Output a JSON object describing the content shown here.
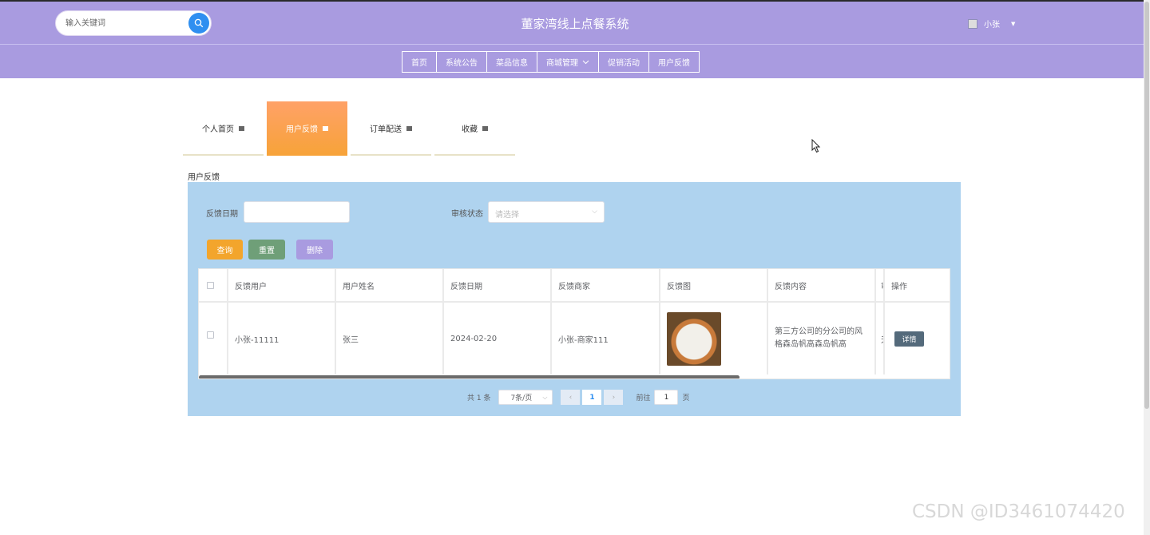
{
  "header": {
    "search_placeholder": "输入关键词",
    "site_title": "董家湾线上点餐系统",
    "username": "小张"
  },
  "nav": [
    "首页",
    "系统公告",
    "菜品信息",
    "商城管理",
    "促销活动",
    "用户反馈"
  ],
  "tabs": [
    {
      "label": "个人首页",
      "active": false
    },
    {
      "label": "用户反馈",
      "active": true
    },
    {
      "label": "订单配送",
      "active": false
    },
    {
      "label": "收藏",
      "active": false
    }
  ],
  "section_label": "用户反馈",
  "filters": {
    "date_label": "反馈日期",
    "status_label": "审核状态",
    "status_placeholder": "请选择"
  },
  "buttons": {
    "query": "查询",
    "reset": "重置",
    "delete": "删除"
  },
  "colors": {
    "header": "#a99be0",
    "tab_active": "#f7a33a",
    "panel": "#afd3ef",
    "query": "#f3a52c",
    "reset": "#6f9f78",
    "delete": "#a99be0",
    "detail": "#546a7b"
  },
  "table": {
    "headers": [
      "反馈用户",
      "用户姓名",
      "反馈日期",
      "反馈商家",
      "反馈图",
      "反馈内容",
      "审",
      "操作"
    ],
    "rows": [
      {
        "user": "小张-11111",
        "name": "张三",
        "date": "2024-02-20",
        "merchant": "小张-商家111",
        "content": "第三方公司的分公司的风格森岛帆高森岛帆高",
        "review_truncated": "天",
        "action": "详情"
      }
    ]
  },
  "pager": {
    "total": "共 1 条",
    "page_size": "7条/页",
    "prev": "‹",
    "current": "1",
    "next": "›",
    "goto_label": "前往",
    "goto_value": "1",
    "page_unit": "页"
  },
  "watermark": "CSDN @ID3461074420"
}
